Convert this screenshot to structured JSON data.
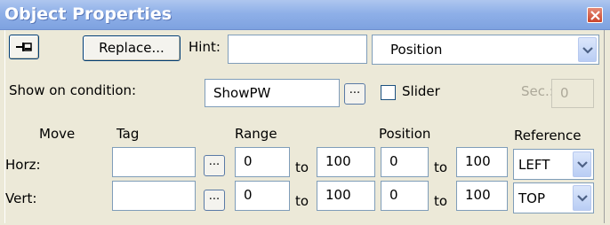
{
  "window": {
    "title": "Object Properties"
  },
  "toolbar": {
    "replace_label": "Replace...",
    "hint_label": "Hint:",
    "hint_value": "",
    "type_select": "Position"
  },
  "condition": {
    "label": "Show on condition:",
    "value": "ShowPW",
    "browse_label": "...",
    "slider_label": "Slider",
    "slider_checked": false,
    "sec_label": "Sec.:",
    "sec_value": "0"
  },
  "headers": {
    "move": "Move",
    "tag": "Tag",
    "range": "Range",
    "position": "Position",
    "reference": "Reference"
  },
  "rows": [
    {
      "label": "Horz:",
      "tag": "",
      "browse": "...",
      "range_from": "0",
      "range_to_label": "to",
      "range_to": "100",
      "pos_from": "0",
      "pos_to_label": "to",
      "pos_to": "100",
      "reference": "LEFT"
    },
    {
      "label": "Vert:",
      "tag": "",
      "browse": "...",
      "range_from": "0",
      "range_to_label": "to",
      "range_to": "100",
      "pos_from": "0",
      "pos_to_label": "to",
      "pos_to": "100",
      "reference": "TOP"
    }
  ],
  "colors": {
    "titlebar": "#8fb0e8",
    "close": "#c9442b",
    "panel": "#ece9d8"
  }
}
